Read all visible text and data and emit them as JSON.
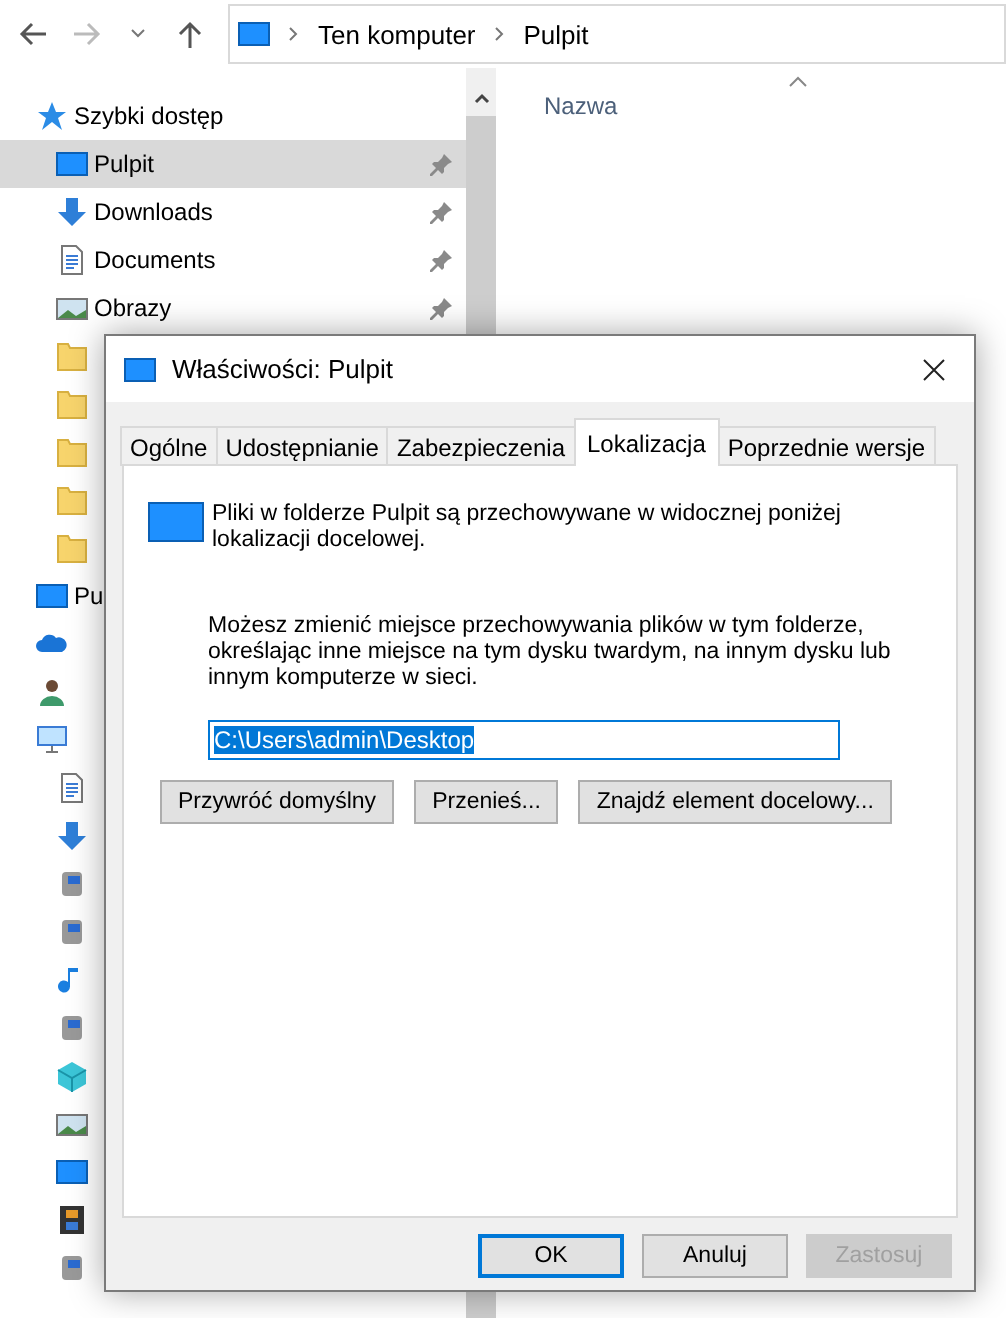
{
  "address": {
    "segments": [
      "Ten komputer",
      "Pulpit"
    ]
  },
  "sidebar": {
    "items": [
      {
        "label": "Szybki dostęp",
        "kind": "star",
        "selected": false,
        "children": [
          {
            "label": "Pulpit",
            "kind": "desktop",
            "selected": true,
            "pinned": true
          },
          {
            "label": "Downloads",
            "kind": "download",
            "selected": false,
            "pinned": true
          },
          {
            "label": "Documents",
            "kind": "document",
            "selected": false,
            "pinned": true
          },
          {
            "label": "Obrazy",
            "kind": "picture",
            "selected": false,
            "pinned": true
          },
          {
            "kind": "folder",
            "selected": false
          },
          {
            "kind": "folder",
            "selected": false
          },
          {
            "kind": "folder",
            "selected": false
          },
          {
            "kind": "folder",
            "selected": false
          },
          {
            "kind": "folder",
            "selected": false
          }
        ]
      },
      {
        "label": "Pu",
        "kind": "desktop",
        "selected": false
      },
      {
        "kind": "cloud",
        "selected": false
      },
      {
        "kind": "user",
        "selected": false
      },
      {
        "kind": "computer",
        "selected": false,
        "children": [
          {
            "kind": "document",
            "selected": false
          },
          {
            "kind": "download",
            "selected": false
          },
          {
            "kind": "drive",
            "selected": false
          },
          {
            "kind": "drive",
            "selected": false
          },
          {
            "kind": "music",
            "selected": false
          },
          {
            "kind": "drive",
            "selected": false
          },
          {
            "kind": "cube",
            "selected": false
          },
          {
            "kind": "picture",
            "selected": false
          },
          {
            "kind": "desktop",
            "selected": false
          },
          {
            "kind": "film",
            "selected": false
          },
          {
            "kind": "drive",
            "selected": false
          }
        ]
      }
    ]
  },
  "content": {
    "columns": [
      "Nazwa"
    ]
  },
  "dialog": {
    "title": "Właściwości: Pulpit",
    "tabs": [
      {
        "label": "Ogólne",
        "selected": false
      },
      {
        "label": "Udostępnianie",
        "selected": false
      },
      {
        "label": "Zabezpieczenia",
        "selected": false
      },
      {
        "label": "Lokalizacja",
        "selected": true
      },
      {
        "label": "Poprzednie wersje",
        "selected": false
      }
    ],
    "info": "Pliki w folderze Pulpit są przechowywane w widocznej poniżej lokalizacji docelowej.",
    "description": "Możesz zmienić miejsce przechowywania plików w tym folderze, określając inne miejsce na tym dysku twardym, na innym dysku lub innym komputerze w sieci.",
    "path": {
      "value": "C:\\Users\\admin\\Desktop",
      "selected": true
    },
    "actions": [
      {
        "label": "Przywróć domyślny"
      },
      {
        "label": "Przenieś..."
      },
      {
        "label": "Znajdź element docelowy..."
      }
    ],
    "buttons": [
      {
        "label": "OK",
        "default": true,
        "disabled": false
      },
      {
        "label": "Anuluj",
        "default": false,
        "disabled": false
      },
      {
        "label": "Zastosuj",
        "default": false,
        "disabled": true
      }
    ]
  }
}
